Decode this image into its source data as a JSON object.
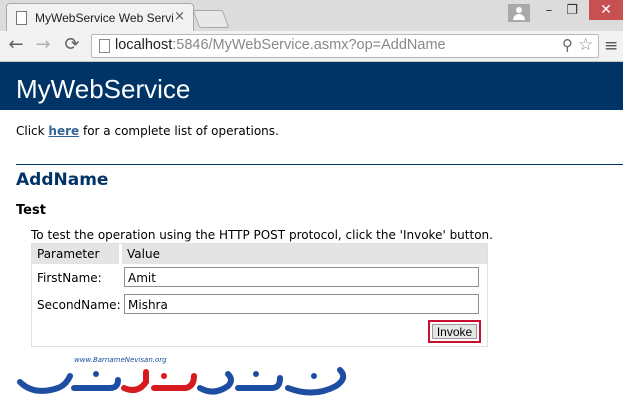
{
  "browser": {
    "tab_title": "MyWebService Web Service",
    "tab_close": "×",
    "url_host": "localhost",
    "url_rest": ":5846/MyWebService.asmx?op=AddName",
    "back": "←",
    "forward": "→",
    "reload": "⟳",
    "zoom": "⚲",
    "star": "☆",
    "menu": "≡",
    "minimize": "–",
    "maximize": "❐",
    "close": "✕"
  },
  "page": {
    "service_title": "MyWebService",
    "intro_before": "Click ",
    "intro_link": "here",
    "intro_after": " for a complete list of operations.",
    "operation": "AddName",
    "section": "Test",
    "instructions": "To test the operation using the HTTP POST protocol, click the 'Invoke' button.",
    "table": {
      "col_param": "Parameter",
      "col_value": "Value",
      "rows": [
        {
          "label": "FirstName:",
          "value": "Amit"
        },
        {
          "label": "SecondName:",
          "value": "Mishra"
        }
      ],
      "invoke_label": "Invoke"
    }
  },
  "watermark": {
    "url_text": "www.BarnameNevisan.org",
    "brand_text": "برنامه نویسان"
  },
  "colors": {
    "banner": "#003366",
    "link": "#336699",
    "highlight": "#c8102e",
    "watermark_blue": "#1e4ea1",
    "watermark_red": "#d71920"
  }
}
